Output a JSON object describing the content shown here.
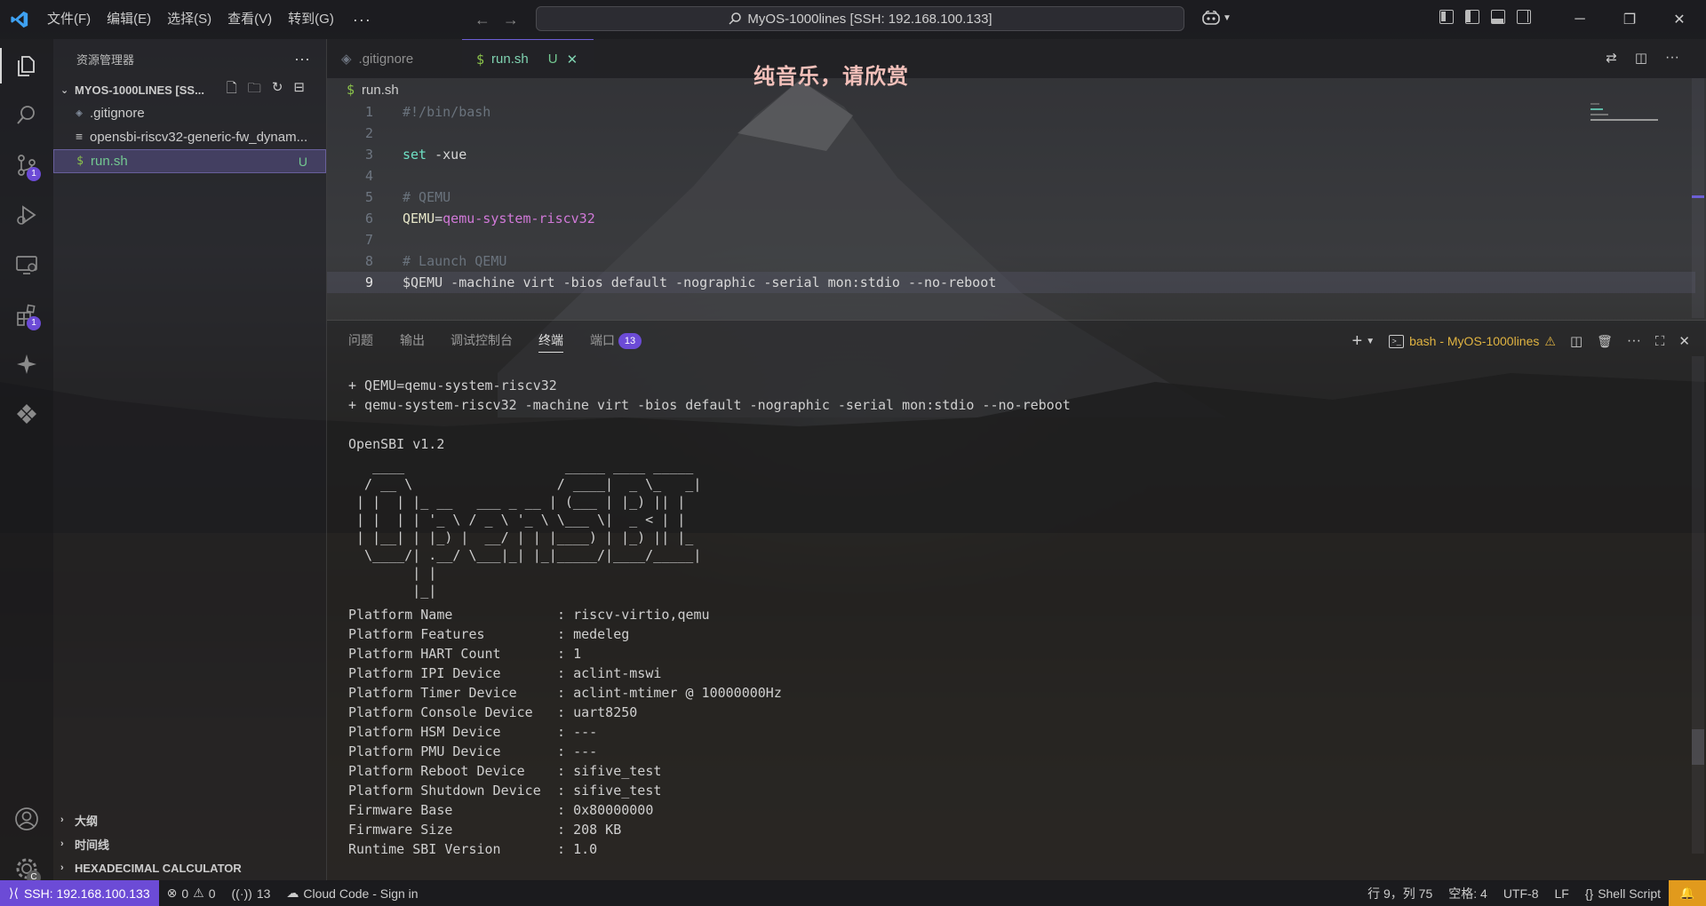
{
  "app": {
    "title": "MyOS-1000lines [SSH: 192.168.100.133]",
    "menu": [
      "文件(F)",
      "编辑(E)",
      "选择(S)",
      "查看(V)",
      "转到(G)"
    ],
    "menu_more": "···",
    "overlay_caption": "纯音乐，请欣赏"
  },
  "activity": {
    "scm_badge": "1",
    "extensions_badge": "1",
    "manage_badge": "C"
  },
  "sidebar": {
    "header": "资源管理器",
    "more": "···",
    "folder": "MYOS-1000LINES [SS...",
    "files": [
      {
        "name": ".gitignore",
        "icon": "gear-icon",
        "git": ""
      },
      {
        "name": "opensbi-riscv32-generic-fw_dynam...",
        "icon": "lines-icon",
        "git": ""
      },
      {
        "name": "run.sh",
        "icon": "dollar-icon",
        "git": "U"
      }
    ],
    "sections": [
      "大纲",
      "时间线",
      "HEXADECIMAL CALCULATOR"
    ]
  },
  "tabs": [
    {
      "label": ".gitignore",
      "active": false
    },
    {
      "label": "run.sh",
      "git": "U",
      "active": true
    }
  ],
  "editor": {
    "breadcrumb": "run.sh",
    "lines": [
      {
        "n": "1",
        "text": "#!/bin/bash"
      },
      {
        "n": "2",
        "text": ""
      },
      {
        "n": "3",
        "kw": "set",
        "rest": " -xue"
      },
      {
        "n": "4",
        "text": ""
      },
      {
        "n": "5",
        "text": "# QEMU"
      },
      {
        "n": "6",
        "var": "QEMU",
        "eq": "=",
        "val": "qemu-system-riscv32"
      },
      {
        "n": "7",
        "text": ""
      },
      {
        "n": "8",
        "text": "# Launch QEMU"
      },
      {
        "n": "9",
        "text": "$QEMU -machine virt -bios default -nographic -serial mon:stdio --no-reboot"
      }
    ]
  },
  "panel": {
    "tabs": [
      {
        "label": "问题"
      },
      {
        "label": "输出"
      },
      {
        "label": "调试控制台"
      },
      {
        "label": "终端",
        "active": true
      },
      {
        "label": "端口",
        "badge": "13"
      }
    ],
    "terminal_name": "bash - MyOS-1000lines",
    "terminal_lines": [
      "+ QEMU=qemu-system-riscv32",
      "+ qemu-system-riscv32 -machine virt -bios default -nographic -serial mon:stdio --no-reboot",
      "",
      "OpenSBI v1.2"
    ],
    "ascii_logo": "   ____                    _____ ____ _____\n  / __ \\                  / ____|  _ \\_   _|\n | |  | |_ __   ___ _ __ | (___ | |_) || |\n | |  | | '_ \\ / _ \\ '_ \\ \\___ \\|  _ < | |\n | |__| | |_) |  __/ | | |____) | |_) || |_\n  \\____/| .__/ \\___|_| |_|_____/|____/_____|\n        | |\n        |_|",
    "platform_info": [
      {
        "k": "Platform Name",
        "v": "riscv-virtio,qemu"
      },
      {
        "k": "Platform Features",
        "v": "medeleg"
      },
      {
        "k": "Platform HART Count",
        "v": "1"
      },
      {
        "k": "Platform IPI Device",
        "v": "aclint-mswi"
      },
      {
        "k": "Platform Timer Device",
        "v": "aclint-mtimer @ 10000000Hz"
      },
      {
        "k": "Platform Console Device",
        "v": "uart8250"
      },
      {
        "k": "Platform HSM Device",
        "v": "---"
      },
      {
        "k": "Platform PMU Device",
        "v": "---"
      },
      {
        "k": "Platform Reboot Device",
        "v": "sifive_test"
      },
      {
        "k": "Platform Shutdown Device",
        "v": "sifive_test"
      },
      {
        "k": "Firmware Base",
        "v": "0x80000000"
      },
      {
        "k": "Firmware Size",
        "v": "208 KB"
      },
      {
        "k": "Runtime SBI Version",
        "v": "1.0"
      }
    ],
    "kv_sep": ": "
  },
  "status": {
    "remote": "SSH: 192.168.100.133",
    "errors": "0",
    "warnings": "0",
    "ports": "13",
    "cloud": "Cloud Code - Sign in",
    "position": "行 9，列 75",
    "spaces": "空格: 4",
    "encoding": "UTF-8",
    "eol": "LF",
    "language": "Shell Script",
    "lang_braces": "{}"
  },
  "colors": {
    "accent": "#6c4bd6",
    "tab_active_text": "#7fd2b0",
    "git_untracked": "#73c991",
    "warning": "#e0b341",
    "overlay_text": "#f3c0ba"
  }
}
